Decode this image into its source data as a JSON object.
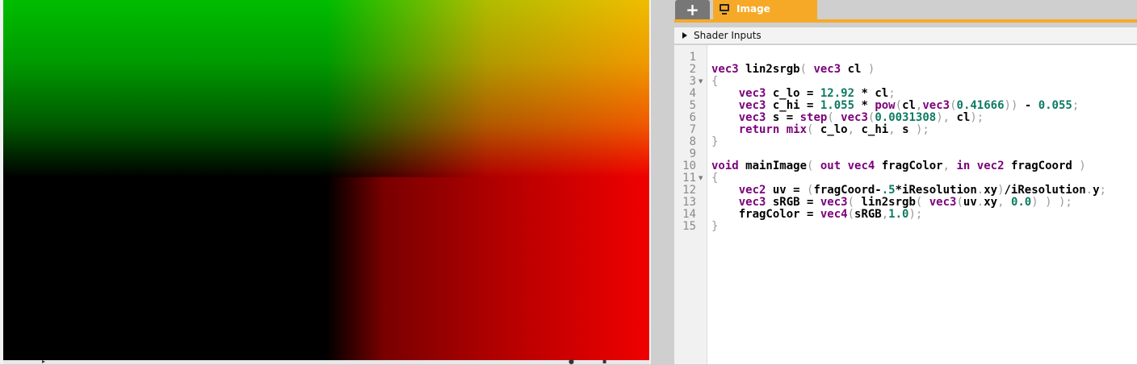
{
  "tabs": {
    "add_label": "+",
    "image_label": "Image"
  },
  "shader_inputs": {
    "label": "Shader Inputs"
  },
  "colors": {
    "tab_active": "#f6a927",
    "keyword": "#7b007b",
    "number": "#0e7a62"
  },
  "icons": {
    "image_tab": "monitor-icon",
    "inputs_toggle": "caret-right-icon",
    "fold_marker": "fold-arrow-icon"
  },
  "code": {
    "line_numbers": [
      "1",
      "2",
      "3",
      "4",
      "5",
      "6",
      "7",
      "8",
      "9",
      "10",
      "11",
      "12",
      "13",
      "14",
      "15"
    ],
    "lines": [
      [],
      [
        {
          "t": "kw",
          "v": "vec3"
        },
        {
          "t": "id",
          "v": " lin2srgb"
        },
        {
          "t": "punc",
          "v": "("
        },
        {
          "t": "kw",
          "v": " vec3"
        },
        {
          "t": "id",
          "v": " cl "
        },
        {
          "t": "punc",
          "v": ")"
        }
      ],
      [
        {
          "t": "punc",
          "v": "{"
        }
      ],
      [
        {
          "t": "id",
          "v": "    "
        },
        {
          "t": "kw",
          "v": "vec3"
        },
        {
          "t": "id",
          "v": " c_lo = "
        },
        {
          "t": "num",
          "v": "12.92"
        },
        {
          "t": "id",
          "v": " * cl"
        },
        {
          "t": "punc",
          "v": ";"
        }
      ],
      [
        {
          "t": "id",
          "v": "    "
        },
        {
          "t": "kw",
          "v": "vec3"
        },
        {
          "t": "id",
          "v": " c_hi = "
        },
        {
          "t": "num",
          "v": "1.055"
        },
        {
          "t": "id",
          "v": " * "
        },
        {
          "t": "kw",
          "v": "pow"
        },
        {
          "t": "punc",
          "v": "("
        },
        {
          "t": "id",
          "v": "cl"
        },
        {
          "t": "punc",
          "v": ","
        },
        {
          "t": "kw",
          "v": "vec3"
        },
        {
          "t": "punc",
          "v": "("
        },
        {
          "t": "num",
          "v": "0.41666"
        },
        {
          "t": "punc",
          "v": "))"
        },
        {
          "t": "id",
          "v": " - "
        },
        {
          "t": "num",
          "v": "0.055"
        },
        {
          "t": "punc",
          "v": ";"
        }
      ],
      [
        {
          "t": "id",
          "v": "    "
        },
        {
          "t": "kw",
          "v": "vec3"
        },
        {
          "t": "id",
          "v": " s = "
        },
        {
          "t": "kw",
          "v": "step"
        },
        {
          "t": "punc",
          "v": "("
        },
        {
          "t": "kw",
          "v": " vec3"
        },
        {
          "t": "punc",
          "v": "("
        },
        {
          "t": "num",
          "v": "0.0031308"
        },
        {
          "t": "punc",
          "v": "),"
        },
        {
          "t": "id",
          "v": " cl"
        },
        {
          "t": "punc",
          "v": ");"
        }
      ],
      [
        {
          "t": "id",
          "v": "    "
        },
        {
          "t": "kw",
          "v": "return"
        },
        {
          "t": "id",
          "v": " "
        },
        {
          "t": "kw",
          "v": "mix"
        },
        {
          "t": "punc",
          "v": "("
        },
        {
          "t": "id",
          "v": " c_lo"
        },
        {
          "t": "punc",
          "v": ","
        },
        {
          "t": "id",
          "v": " c_hi"
        },
        {
          "t": "punc",
          "v": ","
        },
        {
          "t": "id",
          "v": " s "
        },
        {
          "t": "punc",
          "v": ");"
        }
      ],
      [
        {
          "t": "punc",
          "v": "}"
        }
      ],
      [],
      [
        {
          "t": "kw",
          "v": "void"
        },
        {
          "t": "id",
          "v": " mainImage"
        },
        {
          "t": "punc",
          "v": "("
        },
        {
          "t": "kw",
          "v": " out"
        },
        {
          "t": "id",
          "v": " "
        },
        {
          "t": "kw",
          "v": "vec4"
        },
        {
          "t": "id",
          "v": " fragColor"
        },
        {
          "t": "punc",
          "v": ","
        },
        {
          "t": "kw",
          "v": " in"
        },
        {
          "t": "id",
          "v": " "
        },
        {
          "t": "kw",
          "v": "vec2"
        },
        {
          "t": "id",
          "v": " fragCoord "
        },
        {
          "t": "punc",
          "v": ")"
        }
      ],
      [
        {
          "t": "punc",
          "v": "{"
        }
      ],
      [
        {
          "t": "id",
          "v": "    "
        },
        {
          "t": "kw",
          "v": "vec2"
        },
        {
          "t": "id",
          "v": " uv = "
        },
        {
          "t": "punc",
          "v": "("
        },
        {
          "t": "id",
          "v": "fragCoord-"
        },
        {
          "t": "num",
          "v": ".5"
        },
        {
          "t": "id",
          "v": "*iResolution"
        },
        {
          "t": "punc",
          "v": "."
        },
        {
          "t": "id",
          "v": "xy"
        },
        {
          "t": "punc",
          "v": ")"
        },
        {
          "t": "id",
          "v": "/iResolution"
        },
        {
          "t": "punc",
          "v": "."
        },
        {
          "t": "id",
          "v": "y"
        },
        {
          "t": "punc",
          "v": ";"
        }
      ],
      [
        {
          "t": "id",
          "v": "    "
        },
        {
          "t": "kw",
          "v": "vec3"
        },
        {
          "t": "id",
          "v": " sRGB = "
        },
        {
          "t": "kw",
          "v": "vec3"
        },
        {
          "t": "punc",
          "v": "("
        },
        {
          "t": "id",
          "v": " lin2srgb"
        },
        {
          "t": "punc",
          "v": "("
        },
        {
          "t": "kw",
          "v": " vec3"
        },
        {
          "t": "punc",
          "v": "("
        },
        {
          "t": "id",
          "v": "uv"
        },
        {
          "t": "punc",
          "v": "."
        },
        {
          "t": "id",
          "v": "xy"
        },
        {
          "t": "punc",
          "v": ","
        },
        {
          "t": "id",
          "v": " "
        },
        {
          "t": "num",
          "v": "0.0"
        },
        {
          "t": "punc",
          "v": ") ) );"
        }
      ],
      [
        {
          "t": "id",
          "v": "    fragColor = "
        },
        {
          "t": "kw",
          "v": "vec4"
        },
        {
          "t": "punc",
          "v": "("
        },
        {
          "t": "id",
          "v": "sRGB"
        },
        {
          "t": "punc",
          "v": ","
        },
        {
          "t": "num",
          "v": "1.0"
        },
        {
          "t": "punc",
          "v": ");"
        }
      ],
      [
        {
          "t": "punc",
          "v": "}"
        }
      ]
    ],
    "fold_lines": [
      3,
      11
    ]
  }
}
